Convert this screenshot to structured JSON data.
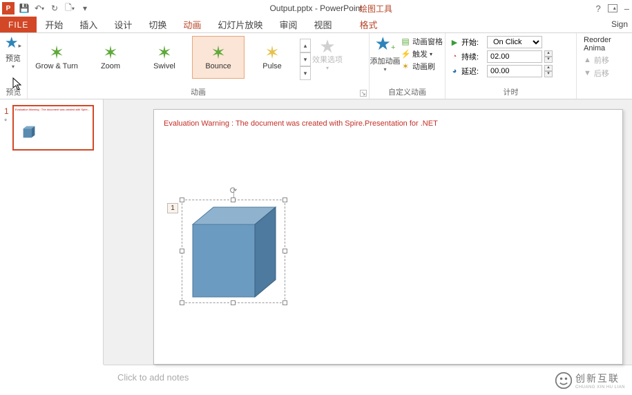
{
  "titlebar": {
    "app_icon": "P",
    "doc_title": "Output.pptx - PowerPoint",
    "tools_context": "绘图工具",
    "help": "?",
    "ribbon_toggle": "▢"
  },
  "qat": {
    "save": "💾",
    "undo": "↶",
    "redo": "↻",
    "new": "▭",
    "more": "▾"
  },
  "tabs": {
    "file": "FILE",
    "home": "开始",
    "insert": "插入",
    "design": "设计",
    "transitions": "切换",
    "animations": "动画",
    "slideshow": "幻灯片放映",
    "review": "审阅",
    "view": "视图",
    "format": "格式",
    "signin": "Sign"
  },
  "preview": {
    "label": "预览",
    "group_label": "预览"
  },
  "gallery": {
    "items": [
      {
        "star": "✶",
        "color": "#5fa83a",
        "label": "Grow & Turn"
      },
      {
        "star": "✶",
        "color": "#5fa83a",
        "label": "Zoom"
      },
      {
        "star": "✶",
        "color": "#5fa83a",
        "label": "Swivel"
      },
      {
        "star": "✶",
        "color": "#5fa83a",
        "label": "Bounce"
      },
      {
        "star": "✶",
        "color": "#e6c24d",
        "label": "Pulse"
      }
    ],
    "group_label": "动画",
    "effect_options": "效果选项"
  },
  "advanced": {
    "add_animation": "添加动画",
    "animation_pane": "动画窗格",
    "trigger": "触发",
    "animation_painter": "动画刷",
    "group_label": "自定义动画"
  },
  "timing": {
    "start_label": "开始:",
    "start_value": "On Click",
    "duration_label": "持续:",
    "duration_value": "02.00",
    "delay_label": "延迟:",
    "delay_value": "00.00",
    "group_label": "计时"
  },
  "reorder": {
    "title": "Reorder Anima",
    "earlier": "前移",
    "later": "后移"
  },
  "thumb": {
    "number": "1",
    "changed": "*"
  },
  "slide": {
    "warning": "Evaluation Warning : The document was created with Spire.Presentation for .NET",
    "seq": "1"
  },
  "notes": {
    "placeholder": "Click to add notes"
  },
  "watermark": {
    "text": "创新互联",
    "sub": "CHUANG XIN HU LIAN"
  }
}
